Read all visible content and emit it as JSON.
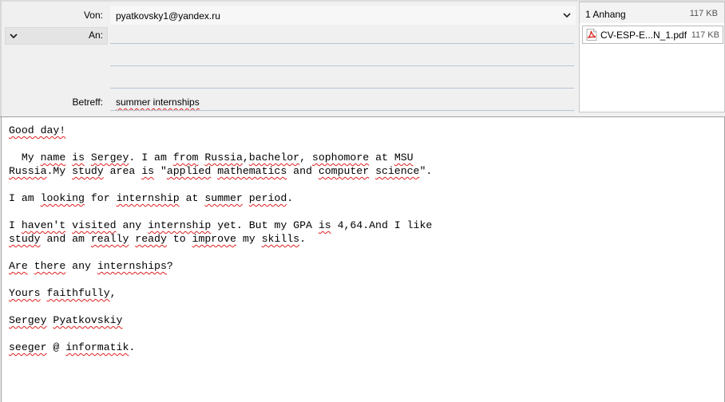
{
  "compose": {
    "from_label": "Von:",
    "from_value": "pyatkovsky1@yandex.ru",
    "to_label": "An:",
    "to_value": "",
    "subject_label": "Betreff:",
    "subject_value": "summer internships"
  },
  "attachments": {
    "header": "1 Anhang",
    "total_size": "117 KB",
    "items": [
      {
        "name": "CV-ESP-E...N_1.pdf",
        "size": "117 KB",
        "icon": "pdf-icon"
      }
    ]
  },
  "message": {
    "lines": [
      "Good day!",
      "",
      "  My name is Sergey. I am from Russia,bachelor, sophomore at MSU",
      "Russia.My study area is \"applied mathematics and computer science\".",
      "",
      "I am looking for internship at summer period.",
      "",
      "I haven't visited any internship yet. But my GPA is 4,64.And I like",
      "study and am really ready to improve my skills.",
      "",
      "Are there any internships?",
      "",
      "Yours faithfully,",
      "",
      "Sergey Pyatkovskiy",
      "",
      "seeger @ informatik."
    ]
  },
  "colors": {
    "spellcheck_underline": "#e02020",
    "pdf_red": "#d9251d",
    "field_line": "#b8c4d4"
  }
}
